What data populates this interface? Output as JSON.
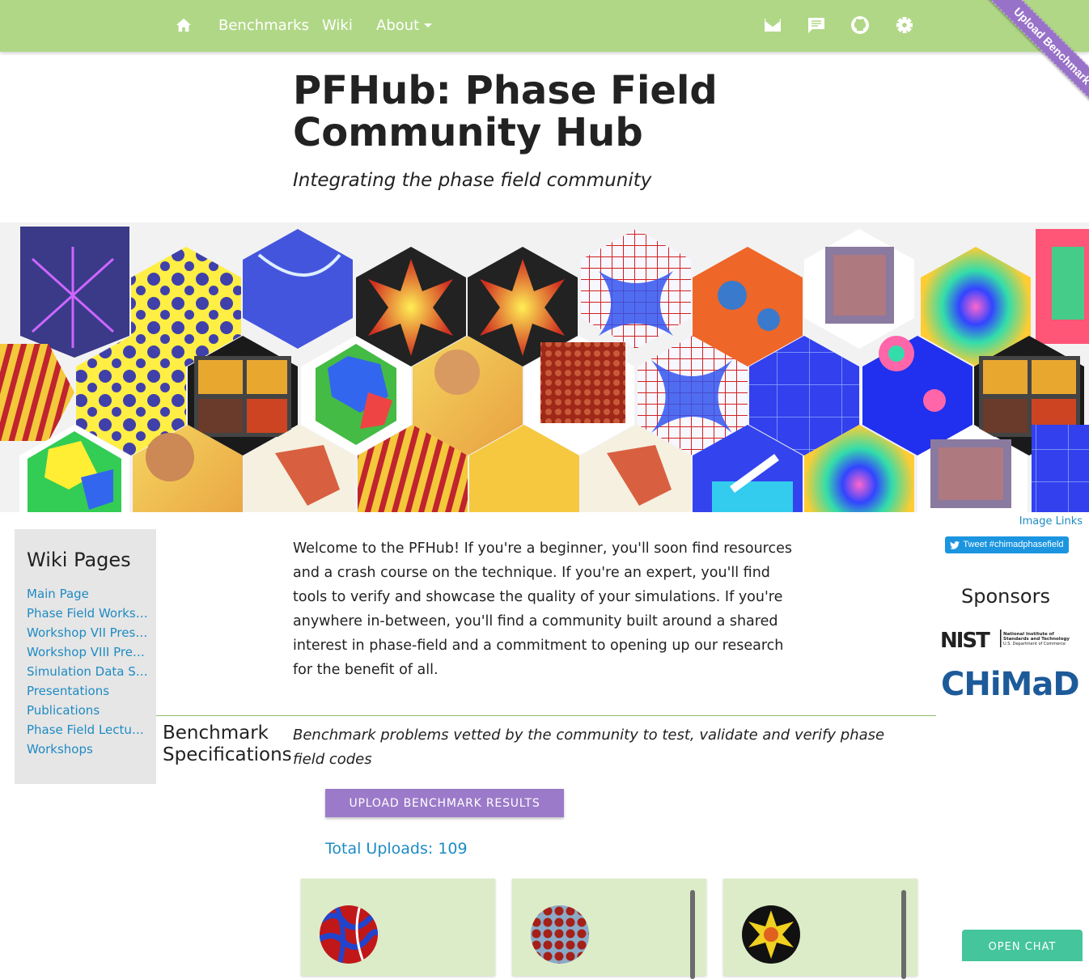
{
  "nav": {
    "home_icon": "home-icon",
    "items": [
      "Benchmarks",
      "Wiki",
      "About"
    ],
    "right_icons": [
      "mail-icon",
      "chat-icon",
      "github-icon",
      "gear-icon"
    ],
    "ribbon": "Upload Benchmark Results",
    "color": "#b0d786"
  },
  "header": {
    "title": "PFHub: Phase Field Community Hub",
    "subtitle": "Integrating the phase field community"
  },
  "banner": {
    "image_links": "Image Links"
  },
  "sidebar": {
    "title": "Wiki Pages",
    "items": [
      "Main Page",
      "Phase Field Workshops",
      "Workshop VII Presentations",
      "Workshop VIII Presentations",
      "Simulation Data Standards",
      "Presentations",
      "Publications",
      "Phase Field Lectures",
      "Workshops"
    ]
  },
  "main": {
    "welcome": "Welcome to the PFHub! If you're a beginner, you'll soon find resources and a crash course on the technique. If you're an expert, you'll find tools to verify and showcase the quality of your simulations. If you're anywhere in-between, you'll find a community built around a shared interest in phase-field and a commitment to opening up our research for the benefit of all.",
    "bench_title": "Benchmark Specifications",
    "bench_desc": "Benchmark problems vetted by the community to test, validate and verify phase field codes",
    "upload_button": "UPLOAD BENCHMARK RESULTS",
    "total_uploads": "Total Uploads: 109"
  },
  "right": {
    "tweet": "Tweet #chimadphasefield",
    "sponsors_title": "Sponsors",
    "nist_sub": "National Institute of Standards and Technology",
    "nist_sub2": "U.S. Department of Commerce",
    "chimad": "CHiMaD"
  },
  "chat": {
    "label": "OPEN CHAT"
  }
}
